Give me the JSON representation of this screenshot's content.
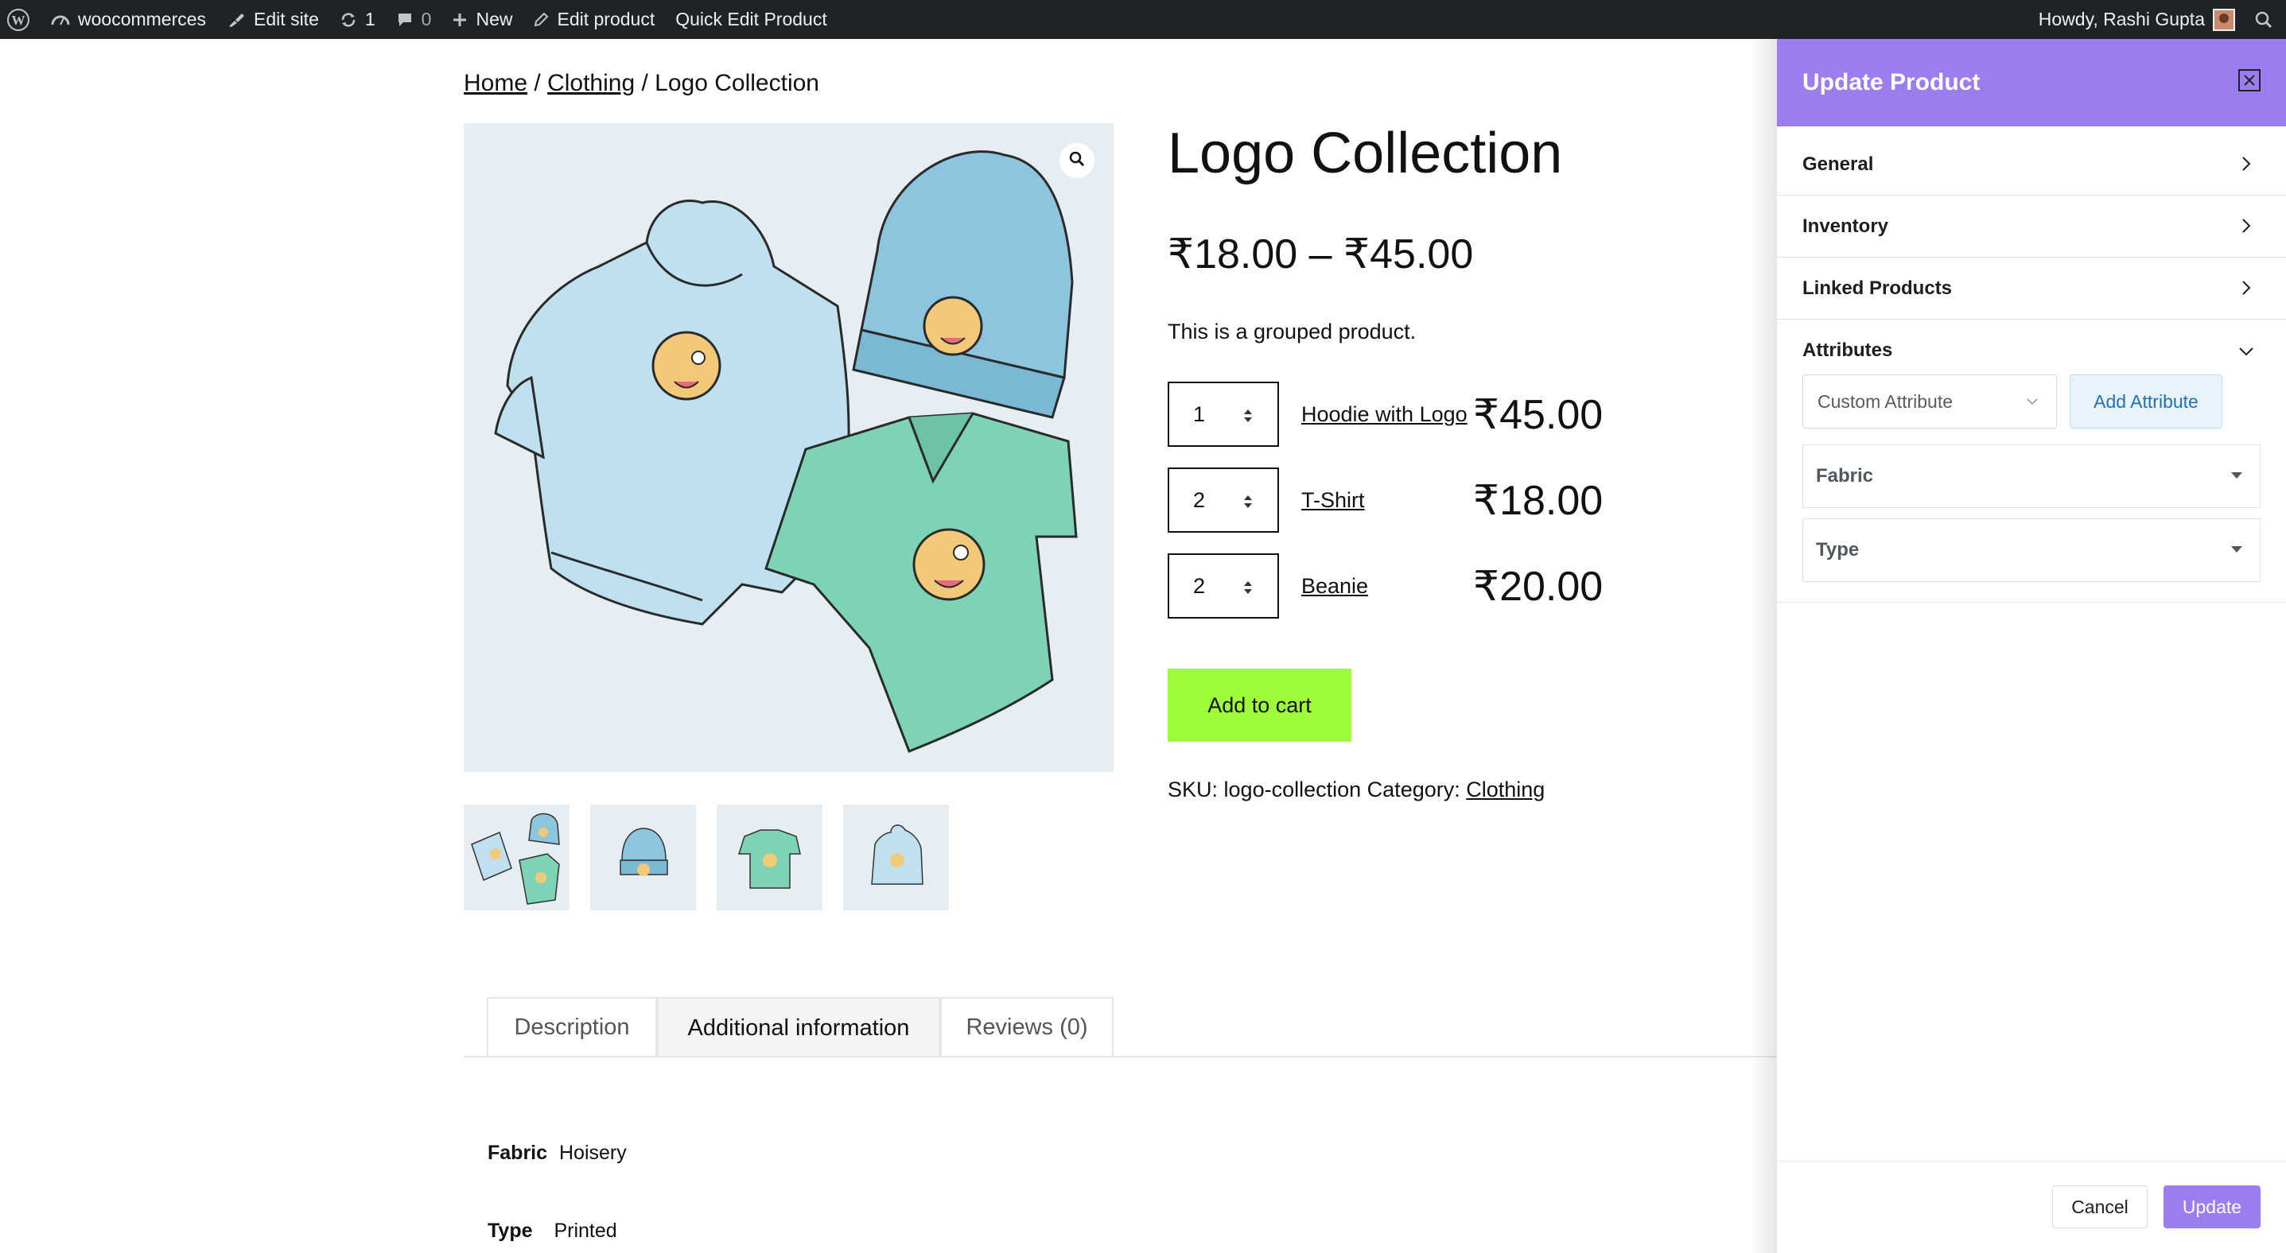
{
  "admin_bar": {
    "site_name": "woocommerces",
    "edit_site": "Edit site",
    "updates_count": "1",
    "comments_count": "0",
    "new_label": "New",
    "edit_product": "Edit product",
    "quick_edit": "Quick Edit Product",
    "greeting": "Howdy, Rashi Gupta"
  },
  "breadcrumb": {
    "home": "Home",
    "sep": "/",
    "category": "Clothing",
    "current": "Logo Collection"
  },
  "product": {
    "title": "Logo Collection",
    "price_range": "₹18.00 – ₹45.00",
    "short_description": "This is a grouped product.",
    "grouped_items": [
      {
        "qty": "1",
        "name": "Hoodie with Logo",
        "price": "₹45.00"
      },
      {
        "qty": "2",
        "name": "T-Shirt",
        "price": "₹18.00"
      },
      {
        "qty": "2",
        "name": "Beanie",
        "price": "₹20.00"
      }
    ],
    "add_to_cart": "Add to cart",
    "sku_label": "SKU:",
    "sku": "logo-collection",
    "category_label": "Category:",
    "category": "Clothing"
  },
  "tabs": [
    {
      "label": "Description"
    },
    {
      "label": "Additional information"
    },
    {
      "label": "Reviews (0)"
    }
  ],
  "additional_info": [
    {
      "name": "Fabric",
      "value": "Hoisery"
    },
    {
      "name": "Type",
      "value": "Printed"
    }
  ],
  "panel": {
    "title": "Update Product",
    "sections": [
      {
        "label": "General"
      },
      {
        "label": "Inventory"
      },
      {
        "label": "Linked Products"
      },
      {
        "label": "Attributes"
      }
    ],
    "attribute_select": "Custom Attribute",
    "add_attribute": "Add Attribute",
    "attributes": [
      {
        "label": "Fabric"
      },
      {
        "label": "Type"
      }
    ],
    "cancel": "Cancel",
    "update": "Update"
  },
  "colors": {
    "panel_header": "#9b7df0",
    "add_to_cart": "#9efc3b",
    "admin_bar": "#1d2327"
  }
}
